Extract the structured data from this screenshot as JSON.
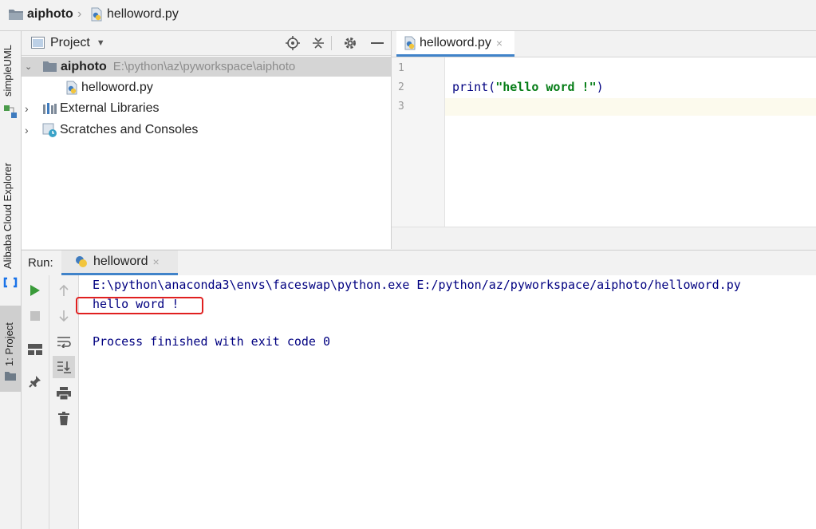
{
  "breadcrumb": {
    "project": "aiphoto",
    "file": "helloword.py"
  },
  "left_strip": {
    "simpleuml": "simpleUML",
    "alibaba": "Alibaba Cloud Explorer",
    "project": "1: Project"
  },
  "project_panel": {
    "title": "Project",
    "tree": [
      {
        "label": "aiphoto",
        "path": "E:\\python\\az\\pyworkspace\\aiphoto"
      },
      {
        "label": "helloword.py"
      },
      {
        "label": "External Libraries"
      },
      {
        "label": "Scratches and Consoles"
      }
    ]
  },
  "editor": {
    "tab": "helloword.py",
    "line_numbers": [
      "1",
      "2",
      "3"
    ],
    "code_prefix": "print(",
    "code_string": "\"hello word !\"",
    "code_suffix": ")"
  },
  "run": {
    "label": "Run:",
    "tab": "helloword",
    "console": [
      "E:\\python\\anaconda3\\envs\\faceswap\\python.exe E:/python/az/pyworkspace/aiphoto/helloword.py",
      "hello word !",
      "Process finished with exit code 0"
    ]
  },
  "colors": {
    "accent": "#4083c9",
    "highlight_box": "#e02020",
    "run_green": "#3a9b3a",
    "console_text": "#000080",
    "string_green": "#067d17"
  }
}
